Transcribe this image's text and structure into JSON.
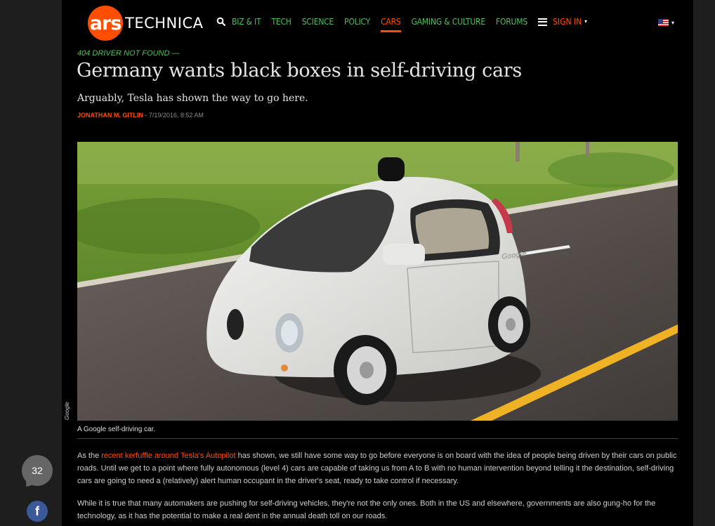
{
  "site": {
    "logo_mark": "ars",
    "logo_word": "TECHNICA"
  },
  "nav": {
    "items": [
      {
        "label": "BIZ & IT"
      },
      {
        "label": "TECH"
      },
      {
        "label": "SCIENCE"
      },
      {
        "label": "POLICY"
      },
      {
        "label": "CARS",
        "active": true
      },
      {
        "label": "GAMING & CULTURE"
      },
      {
        "label": "FORUMS"
      }
    ],
    "signin_label": "SIGN IN",
    "caret": "▾"
  },
  "article": {
    "kicker": "404 DRIVER NOT FOUND —",
    "title": "Germany wants black boxes in self-driving cars",
    "dek": "Arguably, Tesla has shown the way to go here.",
    "author": "JONATHAN M. GITLIN",
    "date": " - 7/19/2016, 8:52 AM",
    "image_credit": "Google",
    "caption": "A Google self-driving car.",
    "car_badge": "Google",
    "p1_before": "As the ",
    "p1_link": "recent kerfuffle around Tesla's Autopilot",
    "p1_after": " has shown, we still have some way to go before everyone is on board with the idea of people being driven by their cars on public roads. Until we get to a point where fully autonomous (level 4) cars are capable of taking us from A to B with no human intervention beyond telling it the destination, self-driving cars are going to need a (relatively) alert human occupant in the driver's seat, ready to take control if necessary.",
    "p2": "While it is true that many automakers are pushing for self-driving vehicles, they're not the only ones. Both in the US and elsewhere, governments are also gung-ho for the technology, as it has the potential to make a real dent in the annual death toll on our roads."
  },
  "rail": {
    "comment_count": "32",
    "facebook_glyph": "f"
  },
  "colors": {
    "accent": "#ff4e00",
    "nav_green": "#4fbf5e",
    "facebook": "#3b5998"
  },
  "icons": [
    "search-icon",
    "menu-icon",
    "flag-icon",
    "facebook-icon",
    "comments-icon"
  ]
}
